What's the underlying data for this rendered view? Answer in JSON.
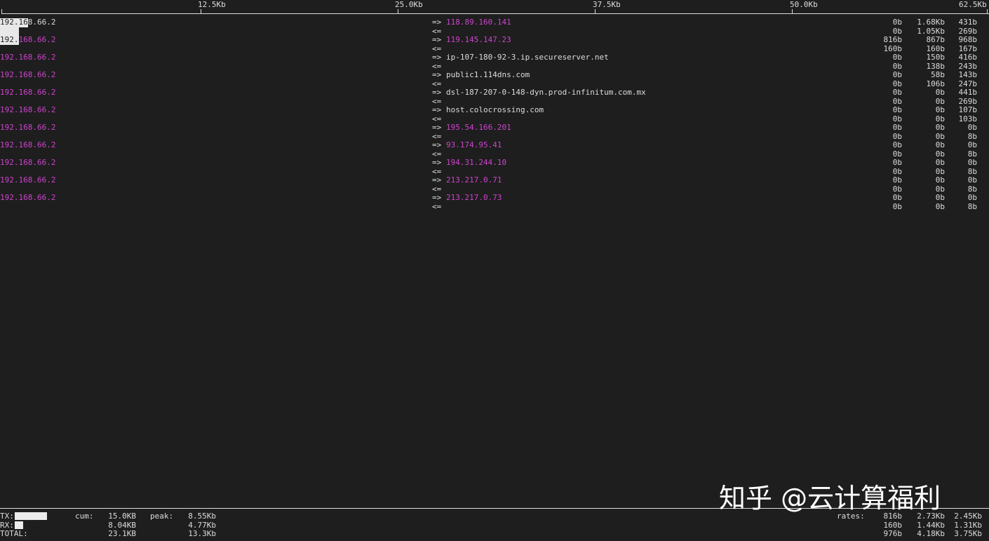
{
  "scale": {
    "ticks": [
      "12.5Kb",
      "25.0Kb",
      "37.5Kb",
      "50.0Kb",
      "62.5Kb"
    ]
  },
  "arrows": {
    "out": "=>",
    "in": "<="
  },
  "connections": [
    {
      "src": "192.168.66.2",
      "dst": "118.89.160.141",
      "dst_kind": "ip",
      "tx": [
        "0b",
        "1.68Kb",
        "431b"
      ],
      "rx": [
        "0b",
        "1.05Kb",
        "269b"
      ]
    },
    {
      "src": "192.168.66.2",
      "dst": "119.145.147.23",
      "dst_kind": "ip",
      "tx": [
        "816b",
        "867b",
        "968b"
      ],
      "rx": [
        "160b",
        "160b",
        "167b"
      ]
    },
    {
      "src": "192.168.66.2",
      "dst": "ip-107-180-92-3.ip.secureserver.net",
      "dst_kind": "host",
      "tx": [
        "0b",
        "150b",
        "416b"
      ],
      "rx": [
        "0b",
        "138b",
        "243b"
      ]
    },
    {
      "src": "192.168.66.2",
      "dst": "public1.114dns.com",
      "dst_kind": "host",
      "tx": [
        "0b",
        "58b",
        "143b"
      ],
      "rx": [
        "0b",
        "106b",
        "247b"
      ]
    },
    {
      "src": "192.168.66.2",
      "dst": "dsl-187-207-0-148-dyn.prod-infinitum.com.mx",
      "dst_kind": "host",
      "tx": [
        "0b",
        "0b",
        "441b"
      ],
      "rx": [
        "0b",
        "0b",
        "269b"
      ]
    },
    {
      "src": "192.168.66.2",
      "dst": "host.colocrossing.com",
      "dst_kind": "host",
      "tx": [
        "0b",
        "0b",
        "107b"
      ],
      "rx": [
        "0b",
        "0b",
        "103b"
      ]
    },
    {
      "src": "192.168.66.2",
      "dst": "195.54.166.201",
      "dst_kind": "ip",
      "tx": [
        "0b",
        "0b",
        "0b"
      ],
      "rx": [
        "0b",
        "0b",
        "8b"
      ]
    },
    {
      "src": "192.168.66.2",
      "dst": "93.174.95.41",
      "dst_kind": "ip",
      "tx": [
        "0b",
        "0b",
        "0b"
      ],
      "rx": [
        "0b",
        "0b",
        "8b"
      ]
    },
    {
      "src": "192.168.66.2",
      "dst": "194.31.244.10",
      "dst_kind": "ip",
      "tx": [
        "0b",
        "0b",
        "0b"
      ],
      "rx": [
        "0b",
        "0b",
        "8b"
      ]
    },
    {
      "src": "192.168.66.2",
      "dst": "213.217.0.71",
      "dst_kind": "ip",
      "tx": [
        "0b",
        "0b",
        "0b"
      ],
      "rx": [
        "0b",
        "0b",
        "8b"
      ]
    },
    {
      "src": "192.168.66.2",
      "dst": "213.217.0.73",
      "dst_kind": "ip",
      "tx": [
        "0b",
        "0b",
        "0b"
      ],
      "rx": [
        "0b",
        "0b",
        "8b"
      ]
    }
  ],
  "footer": {
    "tx_label": "TX:",
    "rx_label": "RX:",
    "total_label": "TOTAL:",
    "cum_label": "cum:",
    "peak_label": "peak:",
    "rates_label": "rates:",
    "cum": {
      "tx": "15.0KB",
      "rx": "8.04KB",
      "total": "23.1KB"
    },
    "peak": {
      "tx": "8.55Kb",
      "rx": "4.77Kb",
      "total": "13.3Kb"
    },
    "rates": {
      "tx": [
        "816b",
        "2.73Kb",
        "2.45Kb"
      ],
      "rx": [
        "160b",
        "1.44Kb",
        "1.31Kb"
      ],
      "total": [
        "976b",
        "4.18Kb",
        "3.75Kb"
      ]
    }
  },
  "watermark": "知乎 @云计算福利"
}
